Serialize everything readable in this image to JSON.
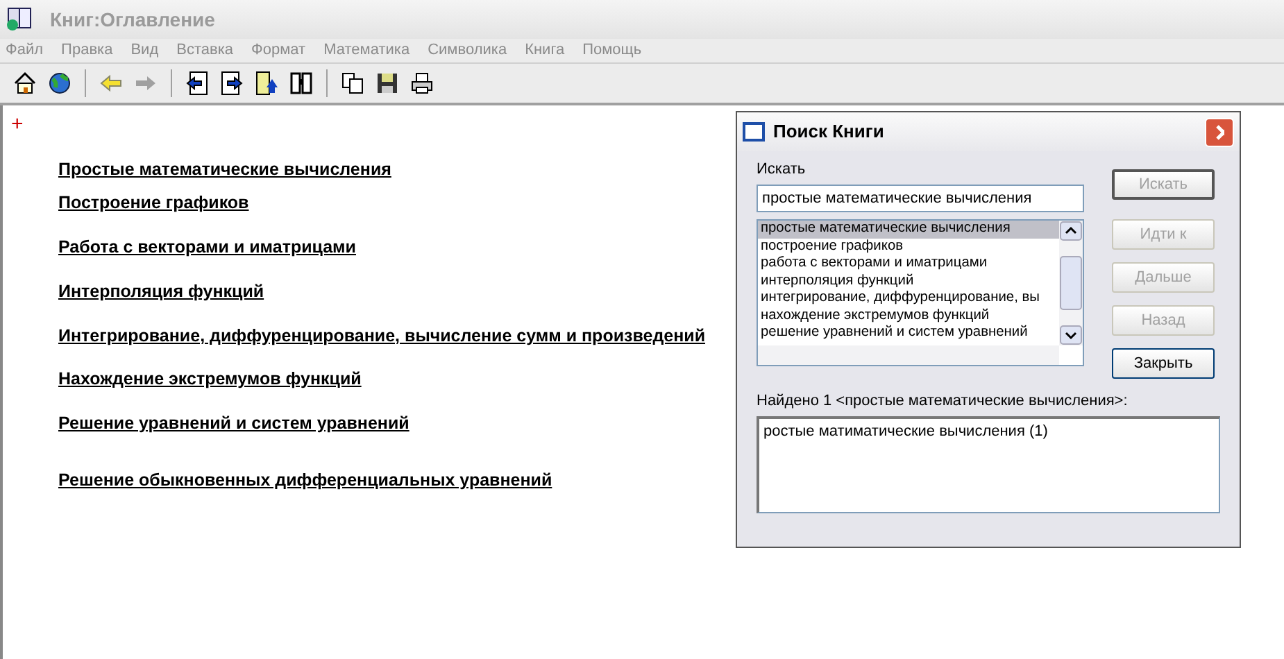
{
  "window": {
    "title": "Книг:Оглавление"
  },
  "menu": [
    {
      "label": "Файл"
    },
    {
      "label": "Правка"
    },
    {
      "label": "Вид"
    },
    {
      "label": "Вставка"
    },
    {
      "label": "Формат"
    },
    {
      "label": "Математика"
    },
    {
      "label": "Символика"
    },
    {
      "label": "Книга"
    },
    {
      "label": "Помощь"
    }
  ],
  "toolbar": [
    {
      "kind": "home"
    },
    {
      "kind": "globe"
    },
    {
      "kind": "sep"
    },
    {
      "kind": "back",
      "disabled": false
    },
    {
      "kind": "forward",
      "disabled": true
    },
    {
      "kind": "sep"
    },
    {
      "kind": "page-prev"
    },
    {
      "kind": "page-next"
    },
    {
      "kind": "page-return"
    },
    {
      "kind": "binoculars"
    },
    {
      "kind": "sep"
    },
    {
      "kind": "copy"
    },
    {
      "kind": "save"
    },
    {
      "kind": "print"
    }
  ],
  "marker": "+",
  "contents": [
    {
      "label": "Простые математические вычисления"
    },
    {
      "label": "Построение графиков"
    },
    {
      "label": "Работа с векторами и иматрицами"
    },
    {
      "label": "Интерполяция функций"
    },
    {
      "label": "Интегрирование, диффуренцирование, вычисление сумм и произведений"
    },
    {
      "label": "Нахождение экстремумов функций"
    },
    {
      "label": "Решение уравнений и систем уравнений"
    },
    {
      "label": "Решение обыкновенных дифференциальных уравнений"
    }
  ],
  "dialog": {
    "title": "Поиск Книги",
    "search_label": "Искать",
    "search_value": "простые математические вычисления",
    "topics": [
      {
        "label": "простые математические вычисления",
        "selected": true
      },
      {
        "label": "построение графиков",
        "selected": false
      },
      {
        "label": "работа с векторами и иматрицами",
        "selected": false
      },
      {
        "label": "интерполяция функций",
        "selected": false
      },
      {
        "label": "интегрирование, диффуренцирование, вы",
        "selected": false
      },
      {
        "label": "нахождение экстремумов функций",
        "selected": false
      },
      {
        "label": "решение уравнений и систем уравнений",
        "selected": false
      }
    ],
    "buttons": [
      {
        "label": "Искать",
        "disabled": true
      },
      {
        "label": "Идти к",
        "disabled": true
      },
      {
        "label": "Дальше",
        "disabled": true
      },
      {
        "label": "Назад",
        "disabled": true
      },
      {
        "label": "Закрыть",
        "disabled": false
      }
    ],
    "found_label": "Найдено 1  <простые математические вычисления>:",
    "results": [
      {
        "label": "ростые матиматические вычисления  (1)"
      }
    ]
  }
}
